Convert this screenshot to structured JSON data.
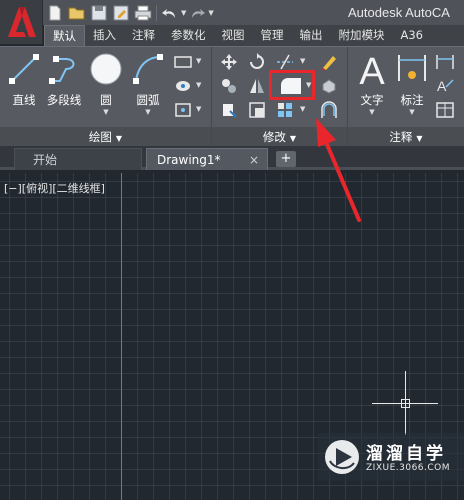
{
  "window": {
    "title": "Autodesk AutoCA"
  },
  "quick_access": {
    "icons": [
      "new-file-icon",
      "open-folder-icon",
      "save-icon",
      "save-as-icon",
      "print-icon",
      "undo-icon",
      "redo-icon"
    ]
  },
  "ribbon_tabs": [
    {
      "label": "默认",
      "active": true
    },
    {
      "label": "插入"
    },
    {
      "label": "注释"
    },
    {
      "label": "参数化"
    },
    {
      "label": "视图"
    },
    {
      "label": "管理"
    },
    {
      "label": "输出"
    },
    {
      "label": "附加模块"
    },
    {
      "label": "A36"
    }
  ],
  "panels": {
    "draw": {
      "label": "绘图",
      "tools": {
        "line": "直线",
        "polyline": "多段线",
        "circle": "圆",
        "arc": "圆弧"
      }
    },
    "modify": {
      "label": "修改"
    },
    "annotation": {
      "label": "注释",
      "tools": {
        "text": "文字",
        "dimension": "标注"
      }
    }
  },
  "document_tabs": {
    "start": "开始",
    "drawing": "Drawing1*",
    "close_glyph": "×",
    "new_glyph": "+"
  },
  "viewport": {
    "label": "[−][俯视][二维线框]"
  },
  "watermark": {
    "title": "溜溜自学",
    "url": "ZIXUE.3066.COM"
  },
  "colors": {
    "accent_red": "#e8262b",
    "ucs_y_axis": "#3fa14a",
    "canvas_bg": "#212830"
  }
}
